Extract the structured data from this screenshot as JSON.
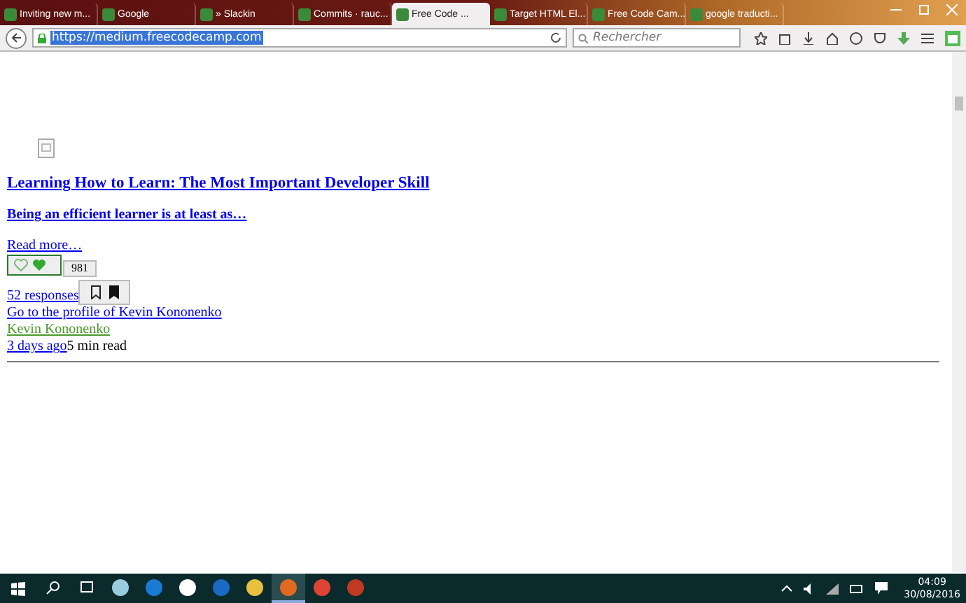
{
  "tabs": [
    {
      "label": "Inviting new m...",
      "selected": false
    },
    {
      "label": "Google",
      "selected": false
    },
    {
      "label": "» Slackin",
      "selected": false
    },
    {
      "label": "Commits · rauc...",
      "selected": false
    },
    {
      "label": "Free Code ...",
      "selected": true
    },
    {
      "label": "Target HTML El...",
      "selected": false
    },
    {
      "label": "Free Code Cam...",
      "selected": false
    },
    {
      "label": "google traducti...",
      "selected": false
    }
  ],
  "address_bar": {
    "value": "https://medium.freecodecamp.com"
  },
  "search": {
    "placeholder": "Rechercher"
  },
  "article": {
    "title": "Learning How to Learn: The Most Important Developer Skill",
    "subtitle": "Being an efficient learner is at least as…",
    "read_more": "Read more…",
    "recommend_count": "981",
    "responses": "52 responses",
    "profile_link": "Go to the profile of Kevin Kononenko",
    "author": "Kevin Kononenko",
    "posted": "3 days ago",
    "read_time": "5 min read"
  },
  "taskbar": {
    "apps": [
      {
        "kind": "cortana",
        "selected": false
      },
      {
        "kind": "taskview",
        "selected": false
      },
      {
        "kind": "notes",
        "selected": false
      },
      {
        "kind": "edge",
        "selected": false
      },
      {
        "kind": "store",
        "selected": false
      },
      {
        "kind": "blue",
        "selected": false
      },
      {
        "kind": "folder",
        "selected": false
      },
      {
        "kind": "firefox",
        "selected": true
      },
      {
        "kind": "chrome",
        "selected": false
      },
      {
        "kind": "p",
        "selected": false
      }
    ],
    "time": "04:09",
    "date": "30/08/2016"
  }
}
